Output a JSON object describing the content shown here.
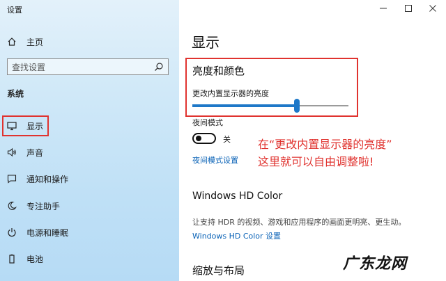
{
  "window": {
    "title": "设置",
    "controls": [
      "minimize-icon",
      "maximize-icon",
      "close-icon"
    ]
  },
  "sidebar": {
    "home_label": "主页",
    "search_placeholder": "查找设置",
    "section_title": "系统",
    "items": [
      {
        "label": "显示",
        "icon": "monitor-icon",
        "selected": true
      },
      {
        "label": "声音",
        "icon": "speaker-icon"
      },
      {
        "label": "通知和操作",
        "icon": "notification-icon"
      },
      {
        "label": "专注助手",
        "icon": "moon-icon"
      },
      {
        "label": "电源和睡眠",
        "icon": "power-icon"
      },
      {
        "label": "电池",
        "icon": "battery-icon"
      }
    ]
  },
  "main": {
    "page_title": "显示",
    "brightness": {
      "title": "亮度和颜色",
      "label": "更改内置显示器的亮度",
      "value_fraction": 0.67
    },
    "night_light": {
      "label": "夜间模式",
      "state_text": "关",
      "is_on": false,
      "settings_link": "夜间模式设置"
    },
    "hd_color": {
      "title": "Windows HD Color",
      "description": "让支持 HDR 的视频、游戏和应用程序的画面更明亮、更生动。",
      "link": "Windows HD Color 设置"
    },
    "scale_title": "缩放与布局"
  },
  "annotation": {
    "line1": "在“更改内置显示器的亮度”",
    "line2": "这里就可以自由调整啦!"
  },
  "watermark": "广东龙网",
  "colors": {
    "accent": "#1e78c8",
    "highlight_border": "#e0332f",
    "link": "#0b63b7"
  }
}
